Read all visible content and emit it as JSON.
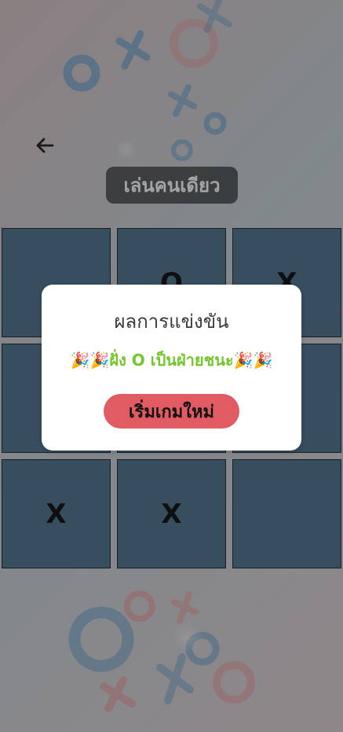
{
  "header": {
    "back_icon": "arrow-left-icon",
    "title": "เล่นคนเดียว"
  },
  "board": {
    "cells": [
      {
        "mark": ""
      },
      {
        "mark": "O"
      },
      {
        "mark": "X"
      },
      {
        "mark": ""
      },
      {
        "mark": ""
      },
      {
        "mark": ""
      },
      {
        "mark": "X"
      },
      {
        "mark": "X"
      },
      {
        "mark": ""
      }
    ]
  },
  "modal": {
    "title": "ผลการแข่งขัน",
    "winner_message": "🎉🎉ฝั่ง O เป็นฝ่ายชนะ🎉🎉",
    "restart_label": "เริ่มเกมใหม่"
  },
  "colors": {
    "background_start": "#c8b6b9",
    "background_end": "#cfc2c6",
    "cell_fill": "#3f6680",
    "title_pill": "#282b2e",
    "winner_text": "#73c62b",
    "button": "#e15b62"
  }
}
